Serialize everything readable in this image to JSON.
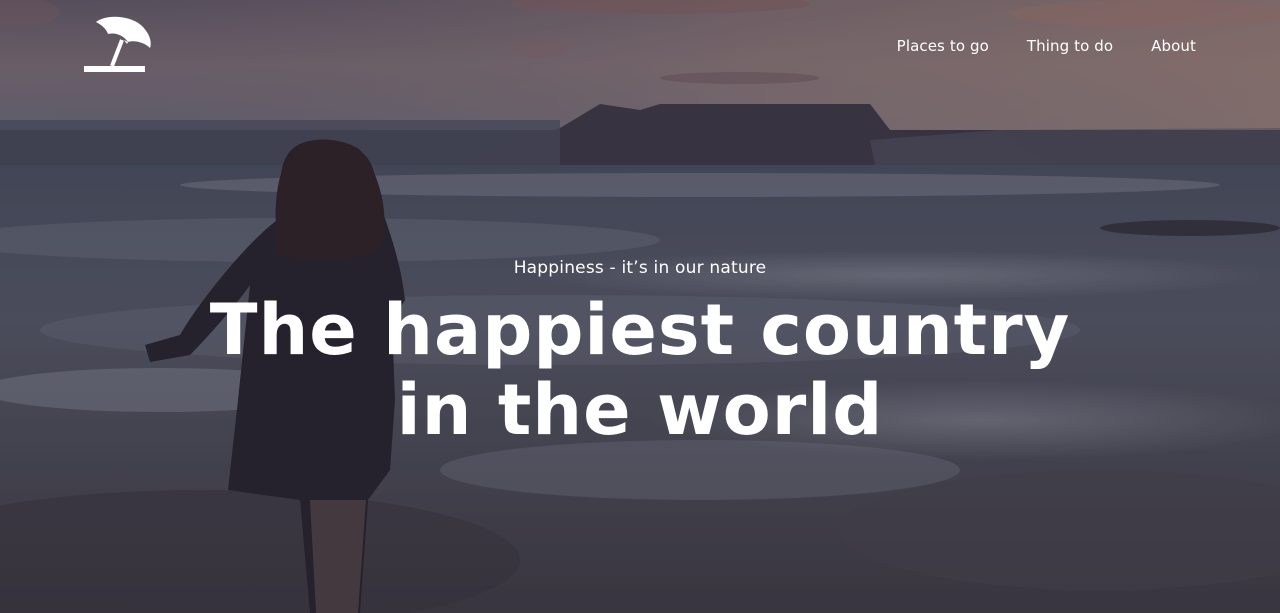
{
  "logo": {
    "icon": "beach-umbrella-icon"
  },
  "nav": {
    "items": [
      {
        "label": "Places to go"
      },
      {
        "label": "Thing to do"
      },
      {
        "label": "About"
      }
    ]
  },
  "hero": {
    "tagline": "Happiness - it’s in our nature",
    "headline": "The happiest country in the world",
    "image": "background-photo-woman-running-on-beach-at-sunset"
  },
  "colors": {
    "text": "#ffffff",
    "sky_top": "#6e6a78",
    "sky_glow": "#b89a92",
    "sea": "#4f5666",
    "mountain": "#4a4454"
  }
}
